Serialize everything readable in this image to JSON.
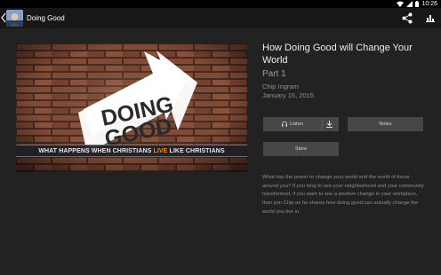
{
  "status_bar": {
    "time": "10:26"
  },
  "app_bar": {
    "title": "Doing Good",
    "back_icon": "chevron-left-icon",
    "share_icon": "share-icon",
    "stats_icon": "bar-chart-icon"
  },
  "hero": {
    "logo_line1": "DOING",
    "logo_line2": "GOOD",
    "tagline_before": "WHAT HAPPENS WHEN CHRISTIANS ",
    "tagline_accent": "LIVE",
    "tagline_after": " LIKE CHRISTIANS",
    "accent_color": "#f08a24"
  },
  "episode": {
    "title": "How Doing Good will Change Your World",
    "part": "Part 1",
    "author": "Chip Ingram",
    "date": "January 16, 2015"
  },
  "actions": {
    "listen_label": "Listen",
    "notes_label": "Notes",
    "store_label": "Store",
    "headphones_icon": "headphones-icon",
    "download_icon": "download-icon"
  },
  "description": "What has the power to change your world and the world of those around you? If you long to see your neighborhood and your community transformed, if you want to see a positive change in your workplace, then join Chip as he shares how doing good can actually change the world you live in.",
  "colors": {
    "background": "#222222",
    "app_bar": "#171717",
    "button": "#474747"
  }
}
